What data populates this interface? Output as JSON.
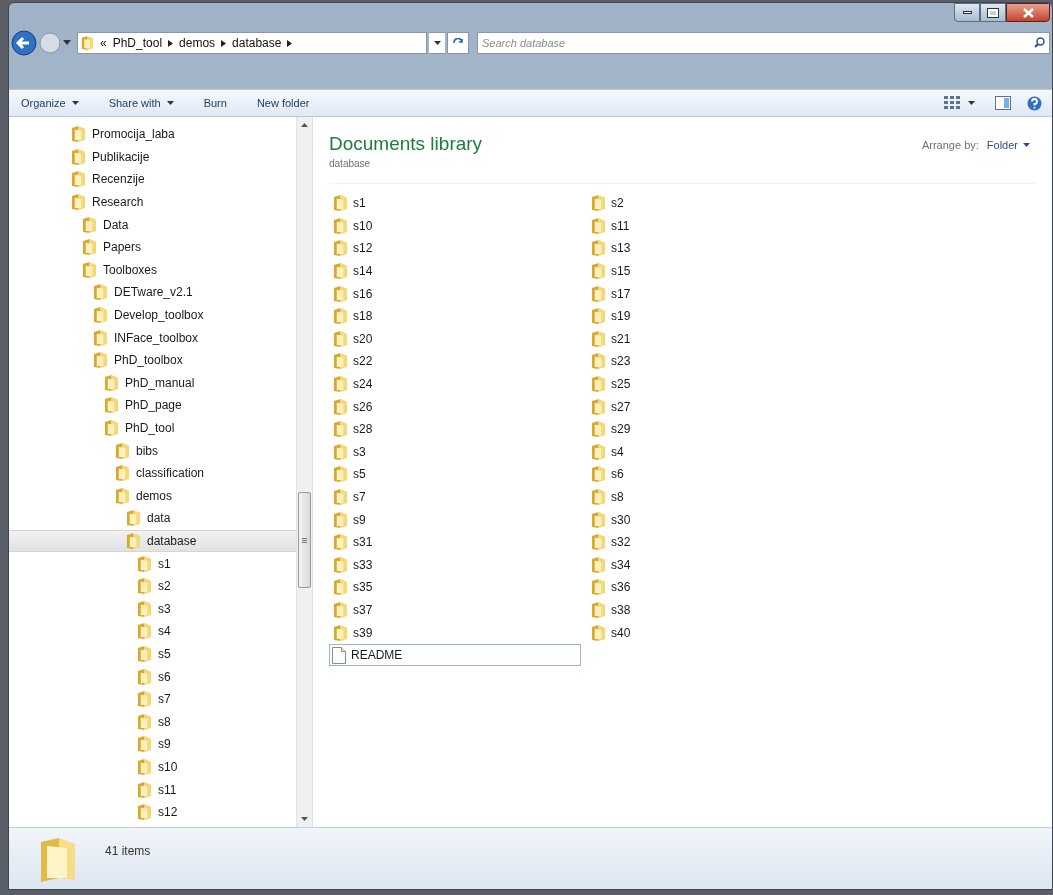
{
  "address": {
    "overflow": "«",
    "segments": [
      "PhD_tool",
      "demos",
      "database"
    ]
  },
  "search": {
    "placeholder": "Search database"
  },
  "toolbar": {
    "items": [
      {
        "label": "Organize",
        "menu": true
      },
      {
        "label": "Share with",
        "menu": true
      },
      {
        "label": "Burn",
        "menu": false
      },
      {
        "label": "New folder",
        "menu": false
      }
    ]
  },
  "tree": [
    {
      "label": "Promocija_laba",
      "selected": false
    },
    {
      "label": "Publikacije",
      "selected": false
    },
    {
      "label": "Recenzije",
      "selected": false
    },
    {
      "label": "Research",
      "selected": false,
      "children": [
        {
          "label": "Data",
          "selected": false
        },
        {
          "label": "Papers",
          "selected": false
        },
        {
          "label": "Toolboxes",
          "selected": false,
          "children": [
            {
              "label": "DETware_v2.1",
              "selected": false
            },
            {
              "label": "Develop_toolbox",
              "selected": false
            },
            {
              "label": "INFace_toolbox",
              "selected": false
            },
            {
              "label": "PhD_toolbox",
              "selected": false,
              "children": [
                {
                  "label": "PhD_manual",
                  "selected": false
                },
                {
                  "label": "PhD_page",
                  "selected": false
                },
                {
                  "label": "PhD_tool",
                  "selected": false,
                  "children": [
                    {
                      "label": "bibs",
                      "selected": false
                    },
                    {
                      "label": "classification",
                      "selected": false
                    },
                    {
                      "label": "demos",
                      "selected": false,
                      "children": [
                        {
                          "label": "data",
                          "selected": false
                        },
                        {
                          "label": "database",
                          "selected": true,
                          "children": [
                            {
                              "label": "s1",
                              "selected": false
                            },
                            {
                              "label": "s2",
                              "selected": false
                            },
                            {
                              "label": "s3",
                              "selected": false
                            },
                            {
                              "label": "s4",
                              "selected": false
                            },
                            {
                              "label": "s5",
                              "selected": false
                            },
                            {
                              "label": "s6",
                              "selected": false
                            },
                            {
                              "label": "s7",
                              "selected": false
                            },
                            {
                              "label": "s8",
                              "selected": false
                            },
                            {
                              "label": "s9",
                              "selected": false
                            },
                            {
                              "label": "s10",
                              "selected": false
                            },
                            {
                              "label": "s11",
                              "selected": false
                            },
                            {
                              "label": "s12",
                              "selected": false
                            }
                          ]
                        }
                      ]
                    }
                  ]
                }
              ]
            }
          ]
        }
      ]
    }
  ],
  "library": {
    "title": "Documents library",
    "subtitle": "database",
    "arrange_label": "Arrange by:",
    "arrange_value": "Folder"
  },
  "items": [
    {
      "name": "s1",
      "kind": "folder",
      "selected": false
    },
    {
      "name": "s2",
      "kind": "folder",
      "selected": false
    },
    {
      "name": "s10",
      "kind": "folder",
      "selected": false
    },
    {
      "name": "s11",
      "kind": "folder",
      "selected": false
    },
    {
      "name": "s12",
      "kind": "folder",
      "selected": false
    },
    {
      "name": "s13",
      "kind": "folder",
      "selected": false
    },
    {
      "name": "s14",
      "kind": "folder",
      "selected": false
    },
    {
      "name": "s15",
      "kind": "folder",
      "selected": false
    },
    {
      "name": "s16",
      "kind": "folder",
      "selected": false
    },
    {
      "name": "s17",
      "kind": "folder",
      "selected": false
    },
    {
      "name": "s18",
      "kind": "folder",
      "selected": false
    },
    {
      "name": "s19",
      "kind": "folder",
      "selected": false
    },
    {
      "name": "s20",
      "kind": "folder",
      "selected": false
    },
    {
      "name": "s21",
      "kind": "folder",
      "selected": false
    },
    {
      "name": "s22",
      "kind": "folder",
      "selected": false
    },
    {
      "name": "s23",
      "kind": "folder",
      "selected": false
    },
    {
      "name": "s24",
      "kind": "folder",
      "selected": false
    },
    {
      "name": "s25",
      "kind": "folder",
      "selected": false
    },
    {
      "name": "s26",
      "kind": "folder",
      "selected": false
    },
    {
      "name": "s27",
      "kind": "folder",
      "selected": false
    },
    {
      "name": "s28",
      "kind": "folder",
      "selected": false
    },
    {
      "name": "s29",
      "kind": "folder",
      "selected": false
    },
    {
      "name": "s3",
      "kind": "folder",
      "selected": false
    },
    {
      "name": "s4",
      "kind": "folder",
      "selected": false
    },
    {
      "name": "s5",
      "kind": "folder",
      "selected": false
    },
    {
      "name": "s6",
      "kind": "folder",
      "selected": false
    },
    {
      "name": "s7",
      "kind": "folder",
      "selected": false
    },
    {
      "name": "s8",
      "kind": "folder",
      "selected": false
    },
    {
      "name": "s9",
      "kind": "folder",
      "selected": false
    },
    {
      "name": "s30",
      "kind": "folder",
      "selected": false
    },
    {
      "name": "s31",
      "kind": "folder",
      "selected": false
    },
    {
      "name": "s32",
      "kind": "folder",
      "selected": false
    },
    {
      "name": "s33",
      "kind": "folder",
      "selected": false
    },
    {
      "name": "s34",
      "kind": "folder",
      "selected": false
    },
    {
      "name": "s35",
      "kind": "folder",
      "selected": false
    },
    {
      "name": "s36",
      "kind": "folder",
      "selected": false
    },
    {
      "name": "s37",
      "kind": "folder",
      "selected": false
    },
    {
      "name": "s38",
      "kind": "folder",
      "selected": false
    },
    {
      "name": "s39",
      "kind": "folder",
      "selected": false
    },
    {
      "name": "s40",
      "kind": "folder",
      "selected": false
    },
    {
      "name": "README",
      "kind": "file",
      "selected": true
    }
  ],
  "status_bar": {
    "count": "41 items"
  }
}
